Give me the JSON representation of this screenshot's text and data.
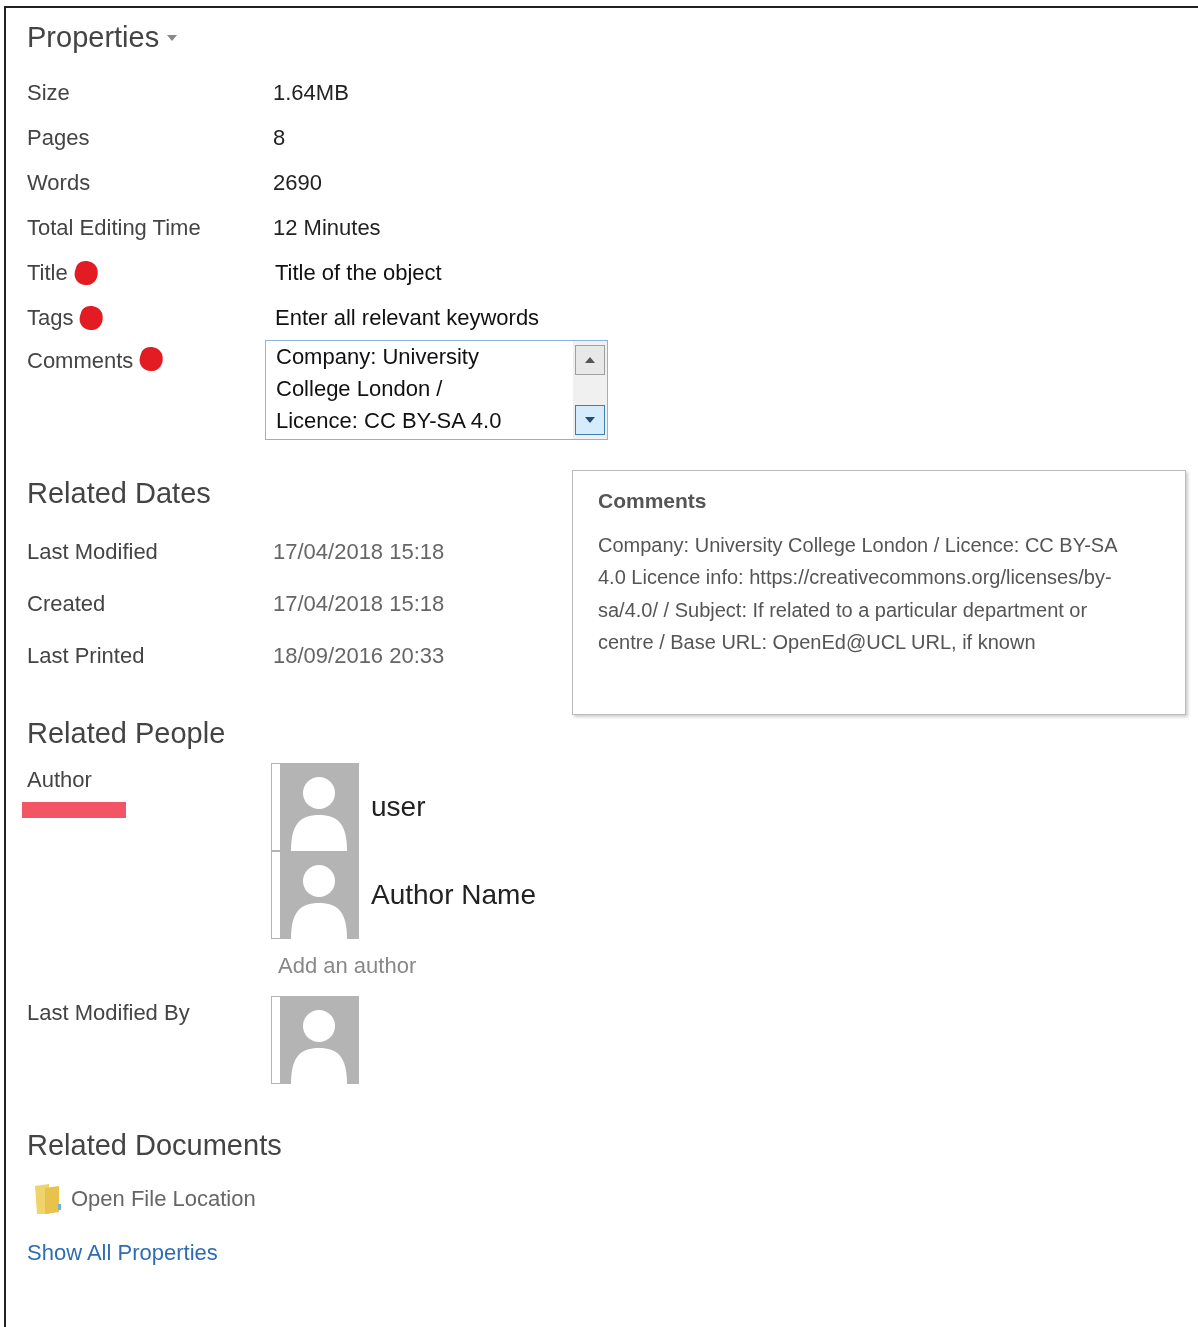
{
  "header": {
    "title": "Properties"
  },
  "properties": [
    {
      "label": "Size",
      "value": "1.64MB",
      "kind": "text",
      "annotated": false
    },
    {
      "label": "Pages",
      "value": "8",
      "kind": "text",
      "annotated": false
    },
    {
      "label": "Words",
      "value": "2690",
      "kind": "text",
      "annotated": false
    },
    {
      "label": "Total Editing Time",
      "value": "12 Minutes",
      "kind": "text",
      "annotated": false
    },
    {
      "label": "Title",
      "value": "Title of the object",
      "kind": "field",
      "annotated": true
    },
    {
      "label": "Tags",
      "value": "Enter all relevant keywords",
      "kind": "field",
      "annotated": true
    },
    {
      "label": "Comments",
      "value": "Company: University College London / Licence: CC BY-SA 4.0",
      "kind": "textarea",
      "annotated": true
    }
  ],
  "related_dates": {
    "title": "Related Dates",
    "rows": [
      {
        "label": "Last Modified",
        "value": "17/04/2018 15:18"
      },
      {
        "label": "Created",
        "value": "17/04/2018 15:18"
      },
      {
        "label": "Last Printed",
        "value": "18/09/2016 20:33"
      }
    ]
  },
  "related_people": {
    "title": "Related People",
    "groups": [
      {
        "label": "Author",
        "annotated": true,
        "people": [
          {
            "kind": "named",
            "name": "user"
          },
          {
            "kind": "named",
            "name": "Author Name"
          }
        ],
        "add_link": "Add an author"
      },
      {
        "label": "Last Modified By",
        "annotated": false,
        "people": [
          {
            "kind": "avatar"
          }
        ]
      }
    ]
  },
  "related_documents": {
    "title": "Related Documents",
    "links": [
      {
        "label": "Open File Location",
        "kind": "folder"
      }
    ]
  },
  "show_all": "Show All Properties",
  "tooltip": {
    "title": "Comments",
    "text": "Company: University College London / Licence: CC BY-SA 4.0 Licence info: https://creativecommons.org/licenses/by-sa/4.0/ / Subject: If related to a particular department or centre / Base URL: OpenEd@UCL URL, if known"
  }
}
